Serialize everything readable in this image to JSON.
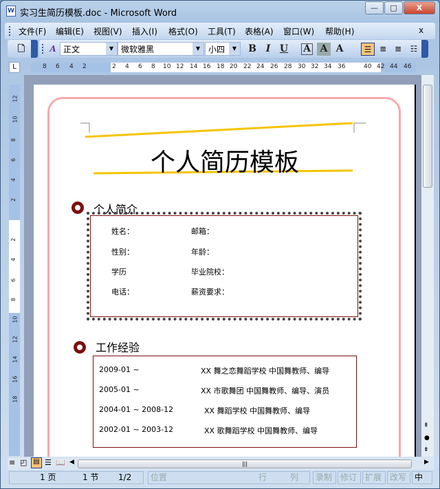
{
  "window": {
    "title": "实习生简历模板.doc - Microsoft Word",
    "icon": "W",
    "min": "—",
    "max": "□",
    "close": "X"
  },
  "menu": [
    "文件(F)",
    "编辑(E)",
    "视图(V)",
    "插入(I)",
    "格式(O)",
    "工具(T)",
    "表格(A)",
    "窗口(W)",
    "帮助(H)"
  ],
  "menu_close": "x",
  "toolbar": {
    "style": "正文",
    "font": "微软雅黑",
    "size": "小四",
    "bold": "B",
    "italic": "I",
    "underline": "U",
    "char_border": "A",
    "char_shade": "A",
    "char_scale": "A"
  },
  "ruler": {
    "left": [
      "8",
      "6",
      "4",
      "2"
    ],
    "mid": [
      "2",
      "4",
      "6",
      "8",
      "10",
      "12",
      "14",
      "16",
      "18",
      "20",
      "22",
      "24",
      "26",
      "28",
      "30",
      "32",
      "34",
      "36"
    ],
    "right": [
      "40",
      "42",
      "44",
      "46"
    ],
    "vertical": [
      "12",
      "10",
      "8",
      "6",
      "4",
      "2",
      "2",
      "4",
      "6",
      "8",
      "10",
      "12",
      "14",
      "16",
      "18"
    ]
  },
  "document": {
    "title": "个人简历模板",
    "section1": {
      "heading": "个人简介",
      "fields": [
        {
          "label": "姓名："
        },
        {
          "label": "邮箱："
        },
        {
          "label": "性别："
        },
        {
          "label": "年龄："
        },
        {
          "label": "学历"
        },
        {
          "label": "毕业院校："
        },
        {
          "label": "电话："
        },
        {
          "label": "薪资要求："
        }
      ]
    },
    "section2": {
      "heading": "工作经验",
      "rows": [
        {
          "period": "2009-01  ~",
          "detail": "XX 舞之恋舞蹈学校  中国舞教师、编导"
        },
        {
          "period": "2005-01  ~",
          "detail": "XX 市歌舞团  中国舞教师、编导、演员"
        },
        {
          "period": "2004-01  ~  2008-12",
          "detail": "XX 舞蹈学校  中国舞教师、编导"
        },
        {
          "period": "2002-01  ~  2003-12",
          "detail": "XX 歌舞蹈学校  中国舞教师、编导"
        }
      ]
    }
  },
  "status": {
    "page": "1 页",
    "section": "1 节",
    "pages": "1/2",
    "position": "位置",
    "line": "行",
    "col": "列",
    "rec": "录制",
    "trk": "修订",
    "ext": "扩展",
    "ovr": "改写",
    "lang": "中文"
  },
  "colors": {
    "accent_ring": "#7d0f0f",
    "frame": "#f7a9ad",
    "highlight_line": "#f5c400"
  }
}
